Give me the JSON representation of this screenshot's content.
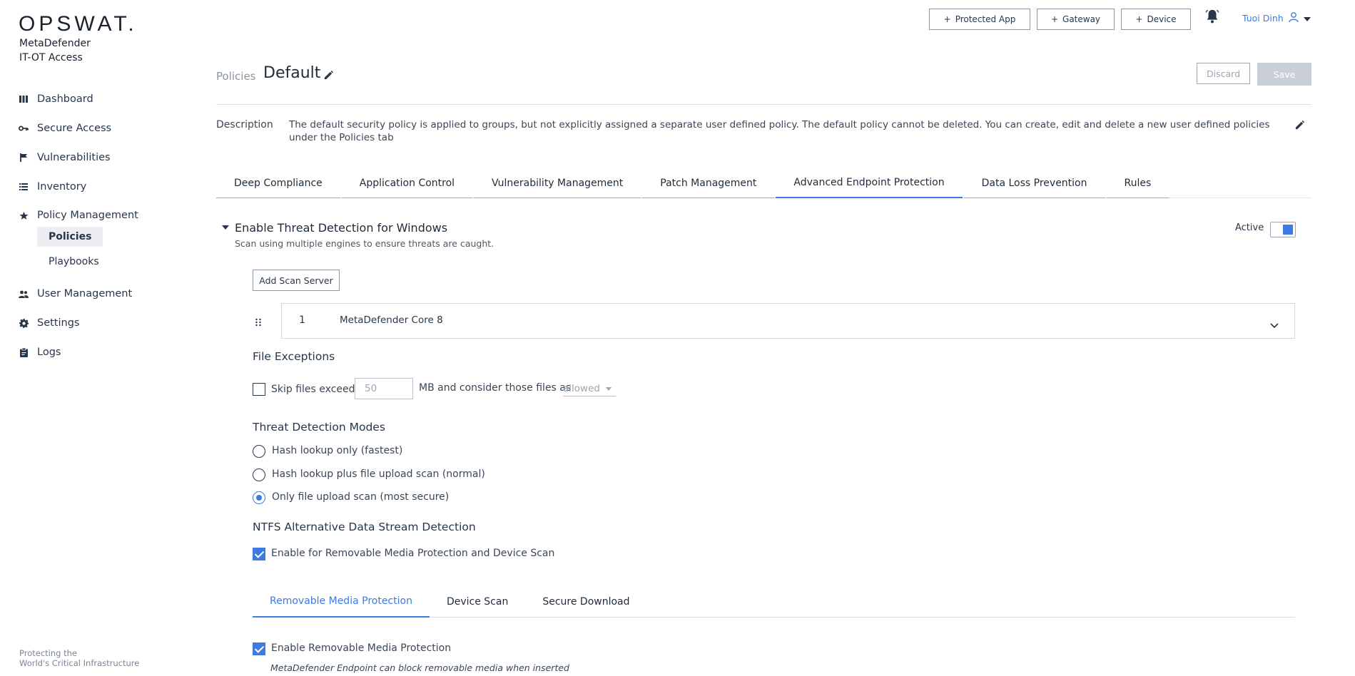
{
  "sidebar": {
    "logo": "OPSWAT.",
    "product_line1": "MetaDefender",
    "product_line2": "IT-OT Access",
    "items": [
      {
        "label": "Dashboard",
        "icon": "dashboard-icon"
      },
      {
        "label": "Secure Access",
        "icon": "key-icon"
      },
      {
        "label": "Vulnerabilities",
        "icon": "flag-icon"
      },
      {
        "label": "Inventory",
        "icon": "list-icon"
      },
      {
        "label": "Policy Management",
        "icon": "star-icon"
      },
      {
        "label": "User Management",
        "icon": "users-icon"
      },
      {
        "label": "Settings",
        "icon": "gear-icon"
      },
      {
        "label": "Logs",
        "icon": "clipboard-icon"
      }
    ],
    "subitems": [
      {
        "label": "Policies",
        "active": true
      },
      {
        "label": "Playbooks",
        "active": false
      }
    ],
    "footer_line1": "Protecting the",
    "footer_line2": "World's Critical Infrastructure"
  },
  "header": {
    "buttons": [
      {
        "label": "Protected App"
      },
      {
        "label": "Gateway"
      },
      {
        "label": "Device"
      }
    ],
    "user_name": "Tuoi Dinh"
  },
  "page": {
    "breadcrumb": "Policies",
    "title": "Default",
    "discard_label": "Discard",
    "save_label": "Save",
    "description_label": "Description",
    "description_text": "The default security policy is applied to groups, but not explicitly assigned a separate user defined policy. The default policy cannot be deleted. You can create, edit and delete a new user defined policies under the Policies tab"
  },
  "tabs": [
    {
      "label": "Deep Compliance"
    },
    {
      "label": "Application Control"
    },
    {
      "label": "Vulnerability Management"
    },
    {
      "label": "Patch Management"
    },
    {
      "label": "Advanced Endpoint Protection",
      "active": true
    },
    {
      "label": "Data Loss Prevention"
    },
    {
      "label": "Rules"
    }
  ],
  "section": {
    "title": "Enable Threat Detection for Windows",
    "subtitle": "Scan using multiple engines to ensure threats are caught.",
    "active_label": "Active",
    "active_on": true,
    "add_scan_server_label": "Add Scan Server",
    "server": {
      "number": "1",
      "name": "MetaDefender Core 8"
    },
    "file_exceptions": {
      "heading": "File Exceptions",
      "skip_label": "Skip files exceed",
      "skip_checked": false,
      "size_value": "50",
      "mid_text": "MB and consider those files as",
      "select_value": "allowed"
    },
    "modes": {
      "heading": "Threat Detection Modes",
      "options": [
        {
          "label": "Hash lookup only (fastest)",
          "checked": false
        },
        {
          "label": "Hash lookup plus file upload scan (normal)",
          "checked": false
        },
        {
          "label": "Only file upload scan (most secure)",
          "checked": true
        }
      ]
    },
    "ntfs": {
      "heading": "NTFS Alternative Data Stream Detection",
      "checkbox_label": "Enable for Removable Media Protection and Device Scan",
      "checked": true
    },
    "subtabs": [
      {
        "label": "Removable Media Protection",
        "active": true
      },
      {
        "label": "Device Scan"
      },
      {
        "label": "Secure Download"
      }
    ],
    "removable": {
      "checkbox_label": "Enable Removable Media Protection",
      "checked": true,
      "hint": "MetaDefender Endpoint can block removable media when inserted"
    }
  },
  "colors": {
    "accent": "#3d7be0",
    "text": "#27364a",
    "muted": "#9ba5b3"
  }
}
